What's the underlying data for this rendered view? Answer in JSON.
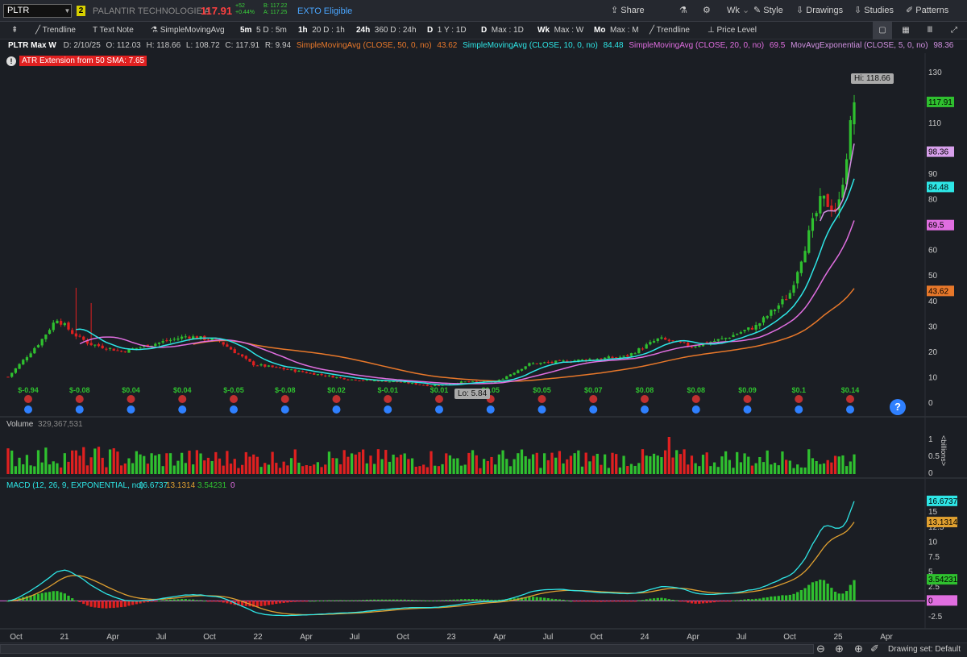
{
  "header": {
    "symbol": "PLTR",
    "link_badge": "2",
    "company": "PALANTIR TECHNOLOGIE A",
    "last_price": "117.91",
    "change": "+52",
    "change_pct": "+0.44%",
    "bid": "B: 117.22",
    "ask": "A: 117.25",
    "exto": "EXTO Eligible",
    "buttons": [
      "Share",
      "Wk",
      "Style",
      "Drawings",
      "Studies",
      "Patterns"
    ]
  },
  "toolbar": {
    "items": [
      {
        "label": "Trendline"
      },
      {
        "label": "Text Note"
      },
      {
        "label": "SimpleMovingAvg"
      },
      {
        "key": "5m",
        "label": "5 D : 5m"
      },
      {
        "key": "1h",
        "label": "20 D : 1h"
      },
      {
        "key": "24h",
        "label": "360 D : 24h"
      },
      {
        "key": "D",
        "label": "1 Y : 1D"
      },
      {
        "key": "D",
        "label": "Max : 1D"
      },
      {
        "key": "Wk",
        "label": "Max : W"
      },
      {
        "key": "Mo",
        "label": "Max : M"
      },
      {
        "label": "Trendline"
      },
      {
        "label": "Price Level"
      }
    ]
  },
  "legend": {
    "title": "PLTR Max W",
    "date": "D: 2/10/25",
    "open": "O: 112.03",
    "high": "H: 118.66",
    "low": "L: 108.72",
    "close": "C: 117.91",
    "range": "R: 9.94",
    "studies": [
      {
        "name": "SimpleMovingAvg (CLOSE, 50, 0, no)",
        "value": "43.62",
        "color": "#e8782a"
      },
      {
        "name": "SimpleMovingAvg (CLOSE, 10, 0, no)",
        "value": "84.48",
        "color": "#2ee6e6"
      },
      {
        "name": "SimpleMovingAvg (CLOSE, 20, 0, no)",
        "value": "69.5",
        "color": "#e06ee0"
      },
      {
        "name": "MovAvgExponential (CLOSE, 5, 0, no)",
        "value": "98.36",
        "color": "#d090e0"
      }
    ]
  },
  "atr_label": "ATR Extension from 50 SMA: 7.65",
  "hi_label": "Hi: 118.66",
  "lo_label": "Lo: 5.84",
  "price_axis": {
    "ticks": [
      "130",
      "110",
      "90",
      "80",
      "60",
      "50",
      "40",
      "30",
      "20",
      "10",
      "0"
    ],
    "badges": [
      {
        "value": "117.91",
        "bg": "#2fc02f",
        "fg": "#000"
      },
      {
        "value": "98.36",
        "bg": "#d8a0ec",
        "fg": "#000"
      },
      {
        "value": "84.48",
        "bg": "#2ee6e6",
        "fg": "#000"
      },
      {
        "value": "69.5",
        "bg": "#e06ee0",
        "fg": "#000"
      },
      {
        "value": "43.62",
        "bg": "#e8782a",
        "fg": "#000"
      }
    ]
  },
  "earnings": [
    "$-0.94",
    "$-0.08",
    "$0.04",
    "$0.04",
    "$-0.05",
    "$-0.08",
    "$0.02",
    "$-0.01",
    "$0.01",
    "$0.05",
    "$0.05",
    "$0.07",
    "$0.08",
    "$0.08",
    "$0.09",
    "$0.1",
    "$0.14"
  ],
  "volume": {
    "label": "Volume",
    "value": "329,367,531",
    "axis_ticks": [
      "1",
      "0.5",
      "0"
    ],
    "unit": "<billions>"
  },
  "macd": {
    "label": "MACD (12, 26, 9, EXPONENTIAL, no)",
    "value": "16.6737",
    "avg": "13.1314",
    "diff": "3.54231",
    "zero": "0",
    "axis_ticks": [
      "15",
      "12.5",
      "10",
      "7.5",
      "5",
      "2.5",
      "-2.5"
    ],
    "badges": [
      {
        "value": "16.6737",
        "color": "#2ee6e6"
      },
      {
        "value": "13.1314",
        "color": "#e0a030"
      },
      {
        "value": "3.54231",
        "color": "#2fc02f"
      },
      {
        "value": "0",
        "color": "#e06ee0"
      }
    ]
  },
  "time_axis": [
    "Oct",
    "21",
    "Apr",
    "Jul",
    "Oct",
    "22",
    "Apr",
    "Jul",
    "Oct",
    "23",
    "Apr",
    "Jul",
    "Oct",
    "24",
    "Apr",
    "Jul",
    "Oct",
    "25",
    "Apr"
  ],
  "status": {
    "drawing_set": "Drawing set: Default"
  },
  "chart_data": {
    "type": "candlestick",
    "title": "PLTR Max W",
    "y_range": [
      0,
      135
    ],
    "approx_weekly_close_path": [
      [
        "2020-10",
        10
      ],
      [
        "2020-12",
        24
      ],
      [
        "2021-01",
        33
      ],
      [
        "2021-02",
        27
      ],
      [
        "2021-03",
        23
      ],
      [
        "2021-05",
        20
      ],
      [
        "2021-07",
        23
      ],
      [
        "2021-09",
        26
      ],
      [
        "2021-11",
        24
      ],
      [
        "2022-01",
        15
      ],
      [
        "2022-04",
        12
      ],
      [
        "2022-07",
        9
      ],
      [
        "2022-10",
        8
      ],
      [
        "2022-12",
        6.5
      ],
      [
        "2023-02",
        8
      ],
      [
        "2023-04",
        8
      ],
      [
        "2023-06",
        15
      ],
      [
        "2023-08",
        16
      ],
      [
        "2023-10",
        17
      ],
      [
        "2023-12",
        18
      ],
      [
        "2024-02",
        25
      ],
      [
        "2024-04",
        22
      ],
      [
        "2024-06",
        25
      ],
      [
        "2024-08",
        30
      ],
      [
        "2024-10",
        42
      ],
      [
        "2024-11",
        62
      ],
      [
        "2024-12",
        80
      ],
      [
        "2025-01",
        75
      ],
      [
        "2025-02",
        117.91
      ]
    ],
    "sma50": 43.62,
    "sma10": 84.48,
    "sma20": 69.5,
    "ema5": 98.36,
    "macd": {
      "value": 16.6737,
      "avg": 13.1314,
      "diff": 3.54231
    }
  }
}
